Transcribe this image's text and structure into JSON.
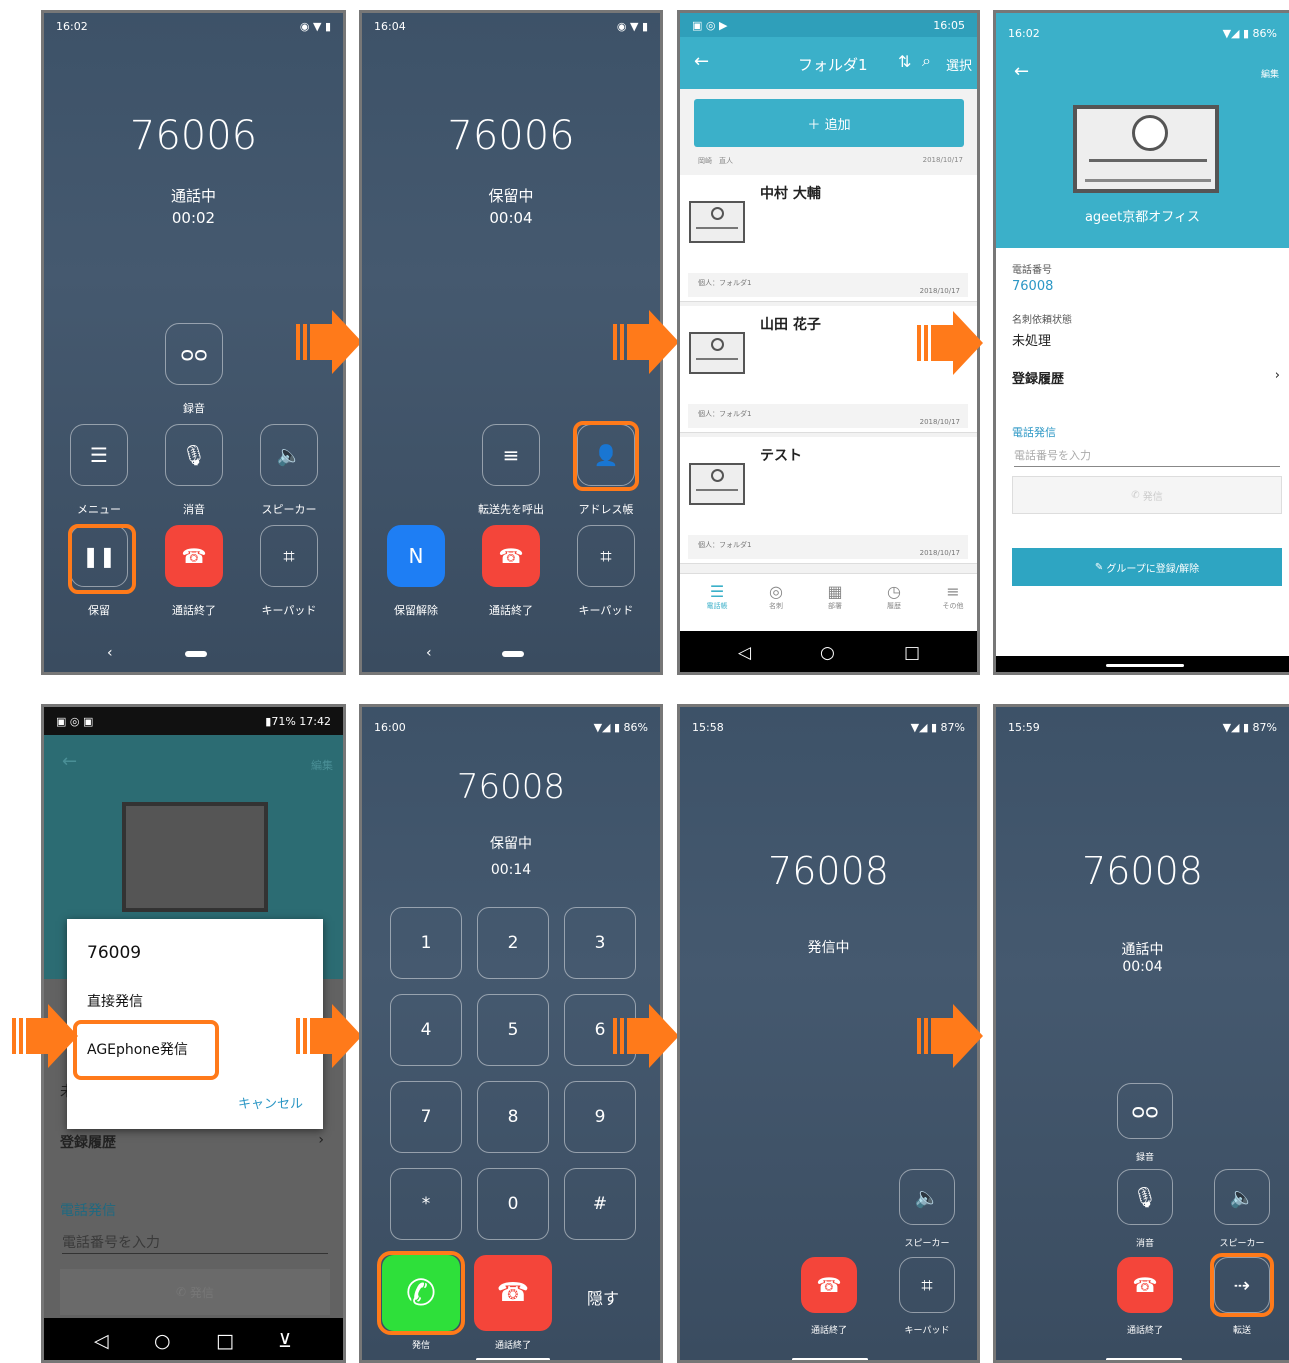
{
  "s1": {
    "time": "16:02",
    "number": "76006",
    "status": "通話中",
    "timer": "00:02",
    "record": "録音",
    "menu": "メニュー",
    "mute": "消音",
    "speaker": "スピーカー",
    "hold": "保留",
    "end": "通話終了",
    "keypad": "キーパッド"
  },
  "s2": {
    "time": "16:04",
    "number": "76006",
    "status": "保留中",
    "timer": "00:04",
    "transfer": "転送先を呼出",
    "address": "アドレス帳",
    "unhold": "保留解除",
    "end": "通話終了",
    "keypad": "キーパッド"
  },
  "s3": {
    "time": "16:05",
    "title": "フォルダ1",
    "select": "選択",
    "add": "追加",
    "hdr_left": "岡崎　直人",
    "hdr_date": "2018/10/17",
    "contacts": [
      {
        "name": "中村 大輔",
        "sub": "個人：フォルダ1",
        "date": "2018/10/17"
      },
      {
        "name": "山田 花子",
        "sub": "個人：フォルダ1",
        "date": "2018/10/17"
      },
      {
        "name": "テスト",
        "sub": "個人：フォルダ1",
        "date": "2018/10/17"
      }
    ],
    "tabs": [
      "電話帳",
      "名刺",
      "部署",
      "履歴",
      "その他"
    ]
  },
  "s4": {
    "time": "16:02",
    "battery": "86%",
    "edit": "編集",
    "org": "ageet京都オフィス",
    "phone_label": "電話番号",
    "phone": "76008",
    "req_label": "名刺依頼状態",
    "req": "未処理",
    "history": "登録履歴",
    "call_label": "電話発信",
    "input_ph": "電話番号を入力",
    "call_btn": "発信",
    "group_btn": "グループに登録/解除"
  },
  "s5": {
    "time": "17:42",
    "battery": "71%",
    "edit": "編集",
    "dialog_num": "76009",
    "direct": "直接発信",
    "age": "AGEphone発信",
    "cancel": "キャンセル",
    "history": "登録履歴",
    "call_label": "電話発信",
    "input_ph": "電話番号を入力",
    "call_btn": "発信",
    "phone_partial": "未"
  },
  "s6": {
    "time": "16:00",
    "battery": "86%",
    "number": "76008",
    "status": "保留中",
    "timer": "00:14",
    "keys": [
      "1",
      "2",
      "3",
      "4",
      "5",
      "6",
      "7",
      "8",
      "9",
      "*",
      "0",
      "#"
    ],
    "call": "発信",
    "end": "通話終了",
    "hide": "隠す"
  },
  "s7": {
    "time": "15:58",
    "battery": "87%",
    "number": "76008",
    "status": "発信中",
    "speaker": "スピーカー",
    "end": "通話終了",
    "keypad": "キーパッド"
  },
  "s8": {
    "time": "15:59",
    "battery": "87%",
    "number": "76008",
    "status": "通話中",
    "timer": "00:04",
    "record": "録音",
    "mute": "消音",
    "speaker": "スピーカー",
    "end": "通話終了",
    "transfer": "転送"
  },
  "colors": {
    "accent": "#ff7a1a",
    "teal": "#3bb0c9",
    "red": "#f4453a",
    "blue": "#1e7ef4",
    "green": "#2ee03a"
  }
}
